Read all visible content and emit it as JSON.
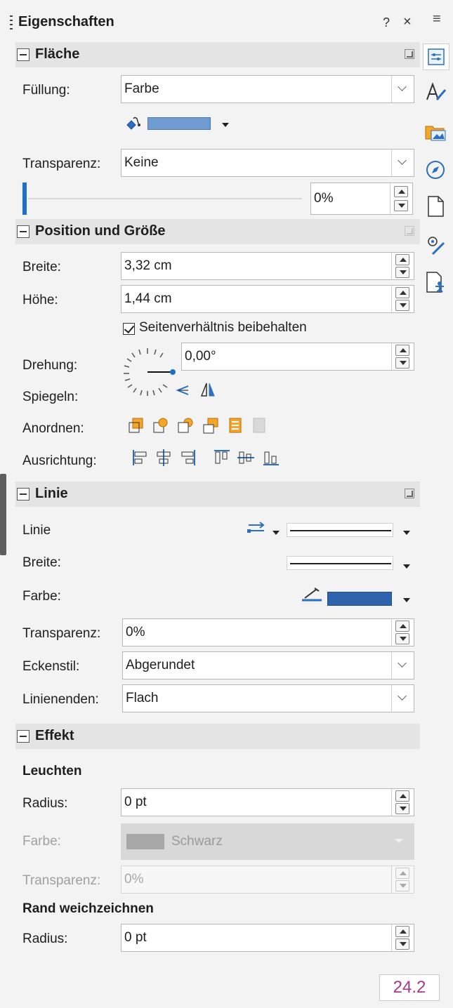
{
  "title": "Eigenschaften",
  "title_help": "?",
  "title_close": "×",
  "menu_icon": "≡",
  "area": {
    "title": "Fläche",
    "fill_label": "Füllung:",
    "fill_value": "Farbe",
    "fill_color": "#6f9bd1",
    "transparency_label": "Transparenz:",
    "transparency_value": "Keine",
    "transparency_percent": "0%"
  },
  "position": {
    "title": "Position und Größe",
    "width_label": "Breite:",
    "width_value": "3,32 cm",
    "height_label": "Höhe:",
    "height_value": "1,44 cm",
    "keep_ratio_label": "Seitenverhältnis beibehalten",
    "rotation_label": "Drehung:",
    "rotation_value": "0,00°",
    "flip_label": "Spiegeln:",
    "arrange_label": "Anordnen:",
    "align_label": "Ausrichtung:"
  },
  "line": {
    "title": "Linie",
    "line_label": "Linie",
    "width_label": "Breite:",
    "color_label": "Farbe:",
    "color": "#2f64ad",
    "transparency_label": "Transparenz:",
    "transparency_value": "0%",
    "corner_label": "Eckenstil:",
    "corner_value": "Abgerundet",
    "cap_label": "Linienenden:",
    "cap_value": "Flach"
  },
  "effect": {
    "title": "Effekt",
    "glow_title": "Leuchten",
    "glow_radius_label": "Radius:",
    "glow_radius_value": "0 pt",
    "glow_color_label": "Farbe:",
    "glow_color_value": "Schwarz",
    "glow_transparency_label": "Transparenz:",
    "glow_transparency_value": "0%",
    "soft_edge_title": "Rand weichzeichnen",
    "soft_radius_label": "Radius:",
    "soft_radius_value": "0 pt"
  },
  "version": "24.2"
}
